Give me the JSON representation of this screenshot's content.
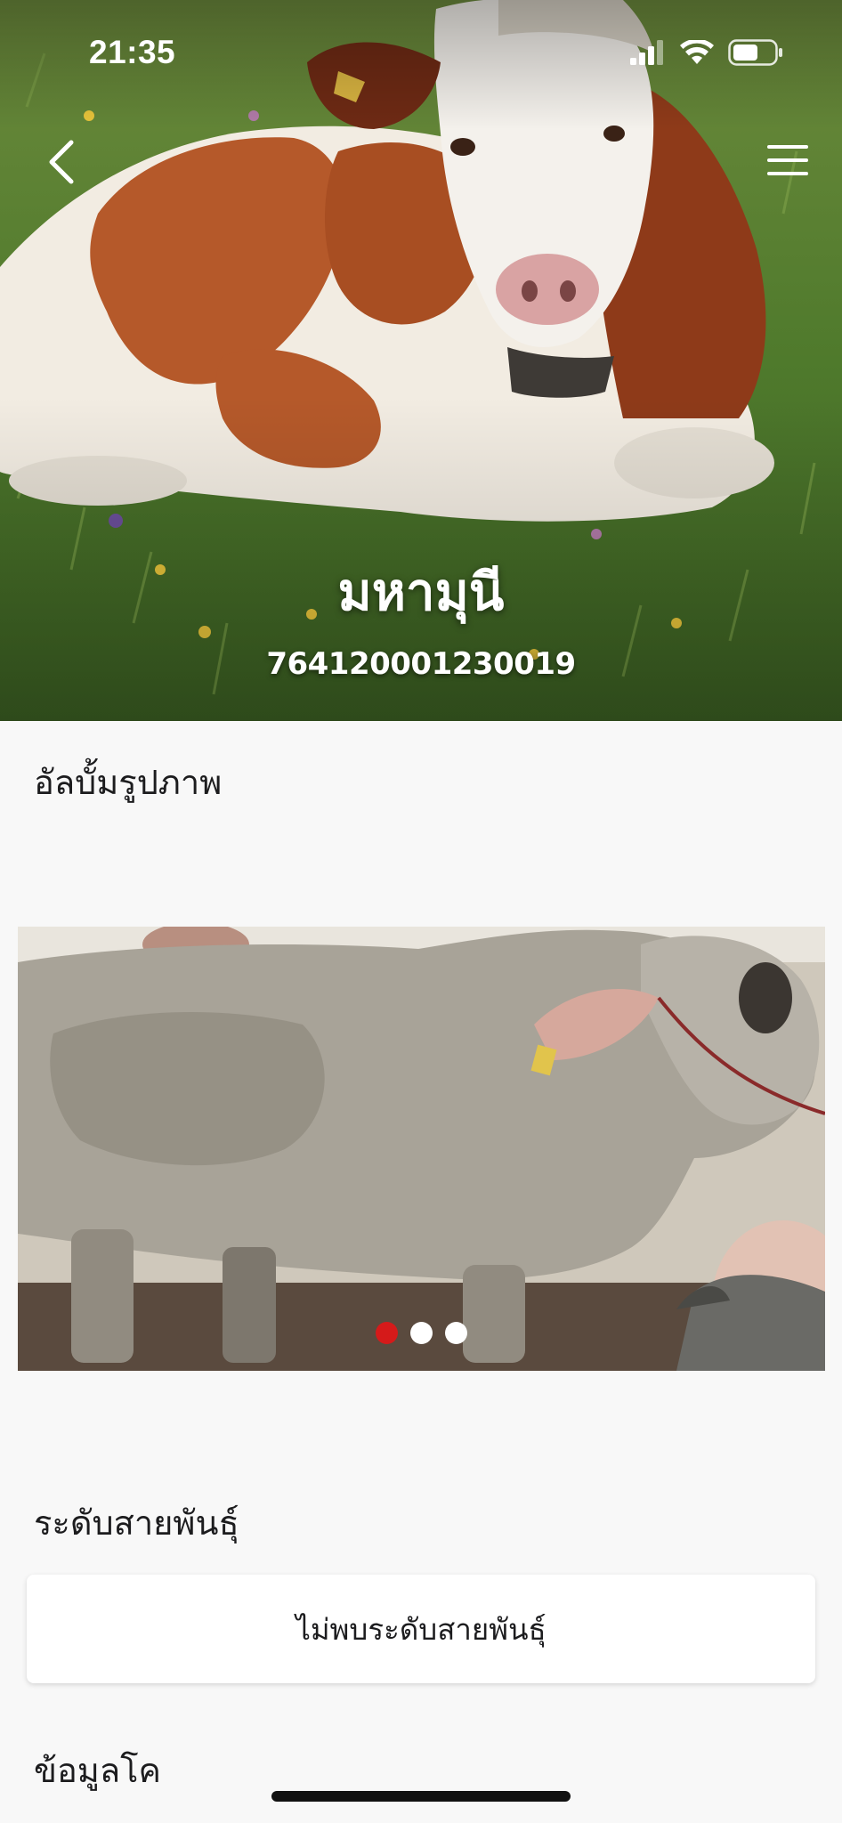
{
  "status_bar": {
    "time": "21:35",
    "icons": [
      "cellular-signal-icon",
      "wifi-icon",
      "battery-icon"
    ]
  },
  "header": {
    "back_icon": "chevron-left-icon",
    "menu_icon": "hamburger-menu-icon",
    "cow_name": "มหามุนี",
    "cow_id": "764120001230019"
  },
  "album": {
    "title": "อัลบั้มรูปภาพ",
    "slide_count": 3,
    "active_slide": 1
  },
  "breed": {
    "title": "ระดับสายพันธุ์",
    "empty_text": "ไม่พบระดับสายพันธุ์"
  },
  "info": {
    "title": "ข้อมูลโค"
  },
  "colors": {
    "background": "#f8f8f8",
    "active_dot": "#d51a1a",
    "inactive_dot": "#ffffff",
    "text": "#1c1c1e"
  }
}
